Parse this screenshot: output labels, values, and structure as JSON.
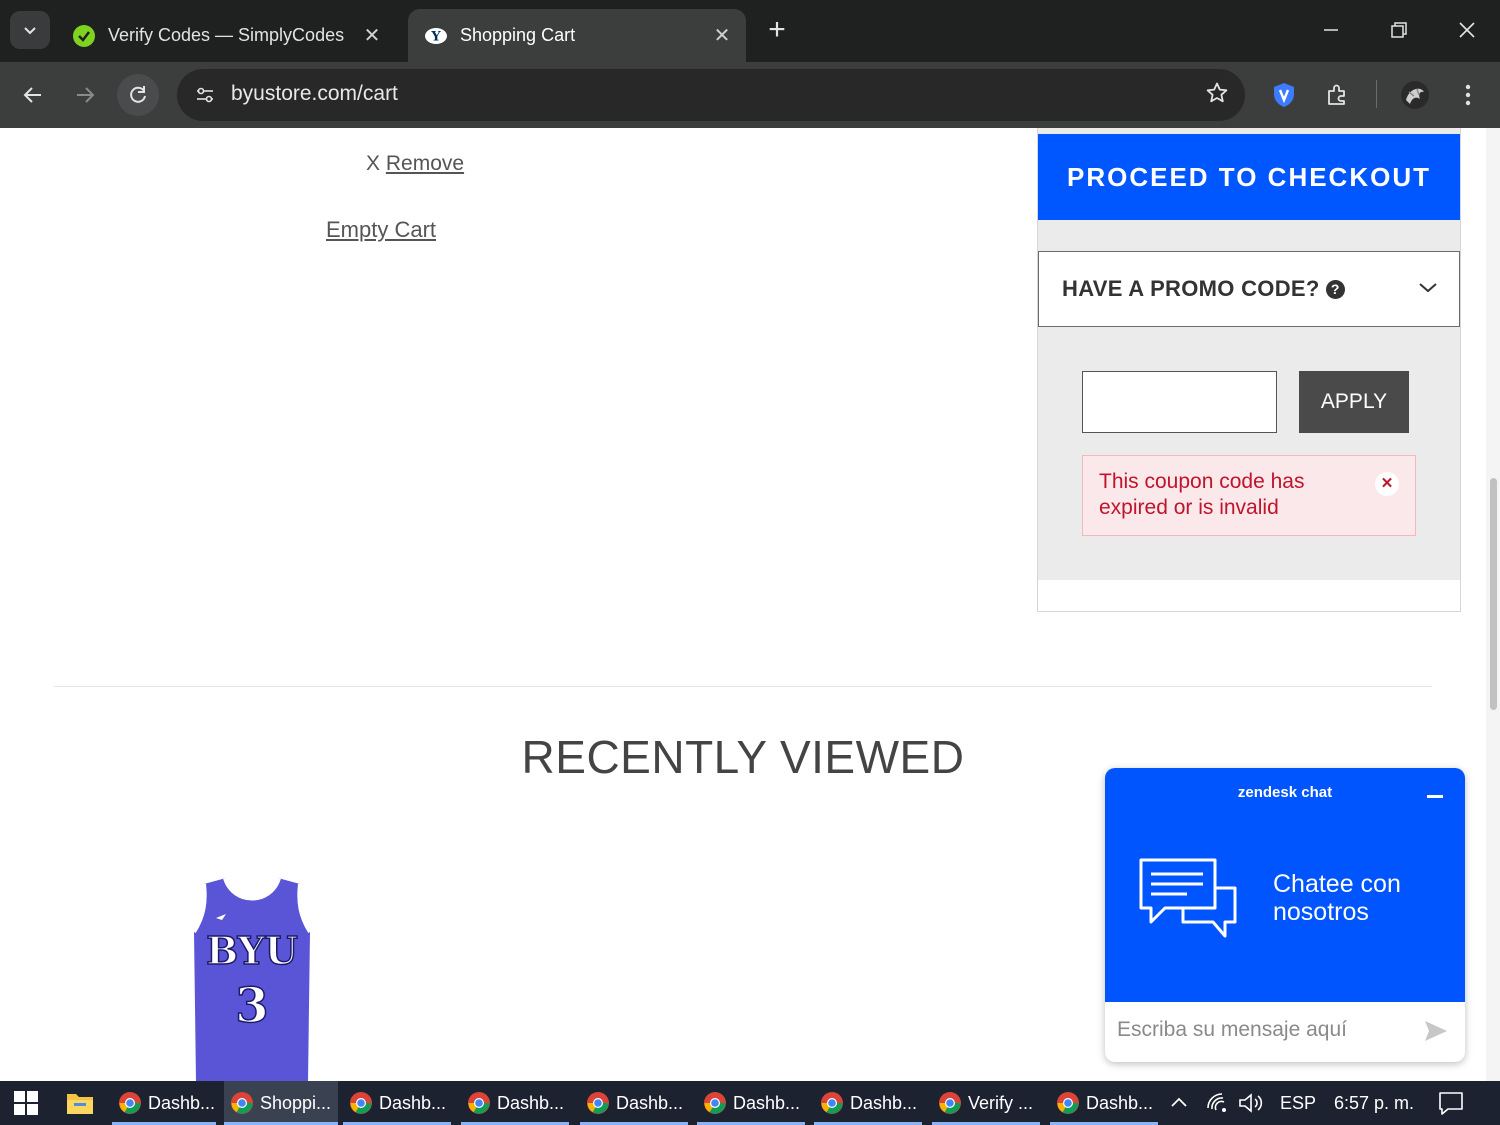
{
  "browser": {
    "tabs": [
      {
        "title": "Verify Codes — SimplyCodes",
        "active": false
      },
      {
        "title": "Shopping Cart",
        "active": true
      }
    ],
    "url": "byustore.com/cart"
  },
  "cart": {
    "remove_prefix": "X",
    "remove_label": "Remove",
    "empty_cart_label": "Empty Cart"
  },
  "summary": {
    "checkout_label": "PROCEED TO CHECKOUT",
    "promo_title": "HAVE A PROMO CODE?",
    "promo_input_value": "",
    "apply_label": "APPLY",
    "alert_message": "This coupon code has expired or is invalid"
  },
  "recently_viewed": {
    "title": "RECENTLY VIEWED",
    "product_image_alt": "BYU 3 basketball jersey"
  },
  "chat": {
    "brand": "zendesk chat",
    "cta": "Chatee con nosotros",
    "input_placeholder": "Escriba su mensaje aquí"
  },
  "taskbar": {
    "items": [
      {
        "label": "Dashb...",
        "active": false
      },
      {
        "label": "Shoppi...",
        "active": true
      },
      {
        "label": "Dashb...",
        "active": false
      },
      {
        "label": "Dashb...",
        "active": false
      },
      {
        "label": "Dashb...",
        "active": false
      },
      {
        "label": "Dashb...",
        "active": false
      },
      {
        "label": "Dashb...",
        "active": false
      },
      {
        "label": "Verify ...",
        "active": false
      },
      {
        "label": "Dashb...",
        "active": false
      }
    ],
    "language": "ESP",
    "time": "6:57 p. m."
  },
  "colors": {
    "brand_blue": "#0057ff",
    "alert_red": "#c0142c",
    "jersey_purple": "#5a55d6"
  }
}
